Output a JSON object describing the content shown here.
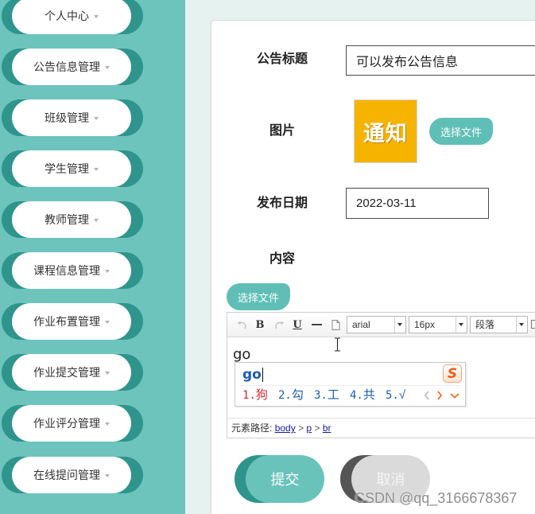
{
  "colors": {
    "sidebar_bg": "#6cc4bd",
    "accent_dark": "#2f948c",
    "accent": "#5fbfb7",
    "page_bg": "#e6f2ef",
    "image_bg": "#f6b400",
    "ime_blue": "#1a5cb4",
    "ime_red": "#e0242f",
    "ime_orange": "#f26c22",
    "link": "#1a1aa6",
    "submit_bg": "#6ac3bb",
    "cancel_dark": "#555555",
    "cancel_bg": "#dadada"
  },
  "sidebar": {
    "items": [
      {
        "label": "个人中心"
      },
      {
        "label": "公告信息管理"
      },
      {
        "label": "班级管理"
      },
      {
        "label": "学生管理"
      },
      {
        "label": "教师管理"
      },
      {
        "label": "课程信息管理"
      },
      {
        "label": "作业布置管理"
      },
      {
        "label": "作业提交管理"
      },
      {
        "label": "作业评分管理"
      },
      {
        "label": "在线提问管理"
      }
    ],
    "item_icon": "chevron-down-icon"
  },
  "form": {
    "title": {
      "label": "公告标题",
      "value": "可以发布公告信息"
    },
    "image": {
      "label": "图片",
      "preview_text": "通知",
      "button": "选择文件"
    },
    "date": {
      "label": "发布日期",
      "value": "2022-03-11"
    },
    "content": {
      "label": "内容",
      "button": "选择文件"
    }
  },
  "editor": {
    "toolbar": {
      "icons": [
        "undo-icon",
        "redo-icon",
        "horizontal-rule-icon",
        "page-icon"
      ],
      "bold": "B",
      "underline": "U",
      "font_family": "arial",
      "font_size": "16px",
      "block_format": "段落"
    },
    "text": "go",
    "path": {
      "label": "元素路径:",
      "separator": ">",
      "nodes": [
        "body",
        "p",
        "br"
      ]
    }
  },
  "ime": {
    "composition": "go",
    "logo_letter": "S",
    "candidates": [
      {
        "index": "1.",
        "text": "狗"
      },
      {
        "index": "2.",
        "text": "勾"
      },
      {
        "index": "3.",
        "text": "工"
      },
      {
        "index": "4.",
        "text": "共"
      },
      {
        "index": "5.",
        "text": "√"
      }
    ],
    "nav_icons": [
      "chevron-left-icon",
      "chevron-right-icon",
      "chevron-down-icon"
    ]
  },
  "actions": {
    "submit": "提交",
    "cancel": "取消"
  },
  "watermark": "CSDN @qq_3166678367"
}
